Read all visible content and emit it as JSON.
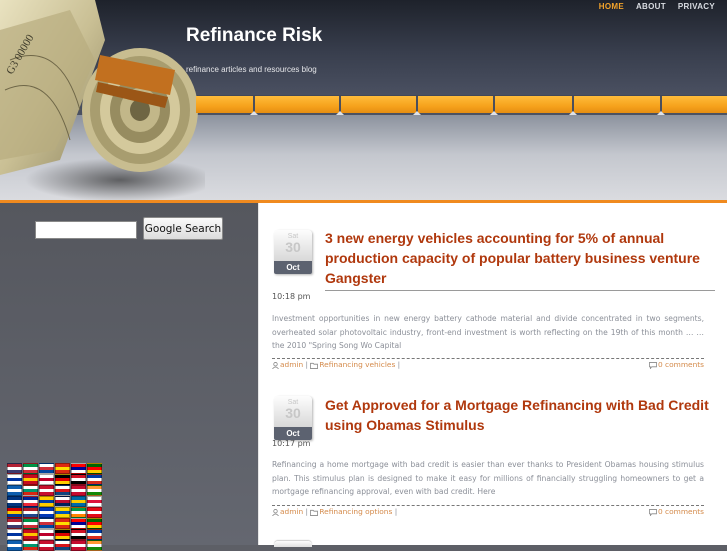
{
  "site": {
    "title": "Refinance Risk",
    "description": "refinance articles and resources blog"
  },
  "topnav": [
    {
      "label": "HOME",
      "active": true
    },
    {
      "label": "ABOUT",
      "active": false
    },
    {
      "label": "PRIVACY",
      "active": false
    }
  ],
  "search": {
    "value": "",
    "button_label": "Google Search"
  },
  "posts": [
    {
      "date": {
        "dow": "Sat",
        "day": "30",
        "month": "Oct"
      },
      "title": "3 new energy vehicles accounting for 5% of annual production capacity of popular battery business venture Gangster",
      "time": "10:18 pm",
      "excerpt": "Investment opportunities in new energy battery cathode material and divide concentrated in two segments, overheated solar photovoltaic industry, front-end investment is worth reflecting on the 19th of this month … … the 2010 \"Spring Song Wo Capital",
      "author": "admin",
      "category": "Refinancing vehicles",
      "comments": "0 comments"
    },
    {
      "date": {
        "dow": "Sat",
        "day": "30",
        "month": "Oct"
      },
      "title": "Get Approved for a Mortgage Refinancing with Bad Credit using Obamas Stimulus",
      "time": "10:17 pm",
      "excerpt": "Refinancing a home mortgage with bad credit is easier than ever thanks to President Obamas housing stimulus plan. This stimulus plan is designed to make it easy for millions of financially struggling homeowners to get a mortgage refinancing approval, even with bad credit. Here",
      "author": "admin",
      "category": "Refinancing options",
      "comments": "0 comments"
    }
  ],
  "colors": {
    "accent": "#f6a21c",
    "title": "#b0380d",
    "nav_active": "#f3a32a"
  },
  "icons": [
    "user-icon",
    "folder-icon",
    "comment-icon",
    "flag-icon"
  ]
}
